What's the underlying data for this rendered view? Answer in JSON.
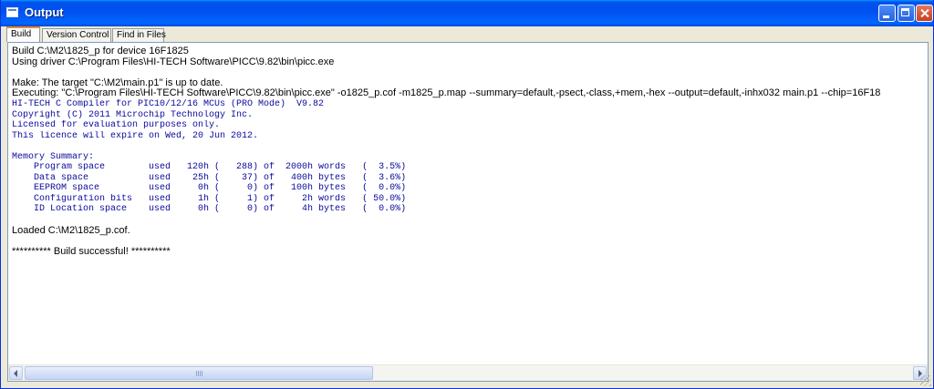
{
  "window": {
    "title": "Output"
  },
  "tabs": [
    "Build",
    "Version Control",
    "Find in Files"
  ],
  "output": {
    "line1": "Build C:\\M2\\1825_p for device 16F1825",
    "line2": "Using driver C:\\Program Files\\HI-TECH Software\\PICC\\9.82\\bin\\picc.exe",
    "line3": "Make: The target \"C:\\M2\\main.p1\" is up to date.",
    "line4": "Executing: \"C:\\Program Files\\HI-TECH Software\\PICC\\9.82\\bin\\picc.exe\" -o1825_p.cof -m1825_p.map --summary=default,-psect,-class,+mem,-hex --output=default,-inhx032 main.p1 --chip=16F18",
    "compiler": "HI-TECH C Compiler for PIC10/12/16 MCUs (PRO Mode)  V9.82",
    "copyright": "Copyright (C) 2011 Microchip Technology Inc.",
    "licensed": "Licensed for evaluation purposes only.",
    "expire": "This licence will expire on Wed, 20 Jun 2012.",
    "memory_title": "Memory Summary:",
    "memory": [
      "    Program space        used   120h (   288) of  2000h words   (  3.5%)",
      "    Data space           used    25h (    37) of   400h bytes   (  3.6%)",
      "    EEPROM space         used     0h (     0) of   100h bytes   (  0.0%)",
      "    Configuration bits   used     1h (     1) of     2h words   ( 50.0%)",
      "    ID Location space    used     0h (     0) of     4h bytes   (  0.0%)"
    ],
    "loaded": "Loaded C:\\M2\\1825_p.cof.",
    "success": "********** Build successful! **********"
  },
  "colors": {
    "title_bar": "#0054e3",
    "output_text_blue": "#0a0a9c",
    "active_tab_accent": "#e68b2c"
  }
}
